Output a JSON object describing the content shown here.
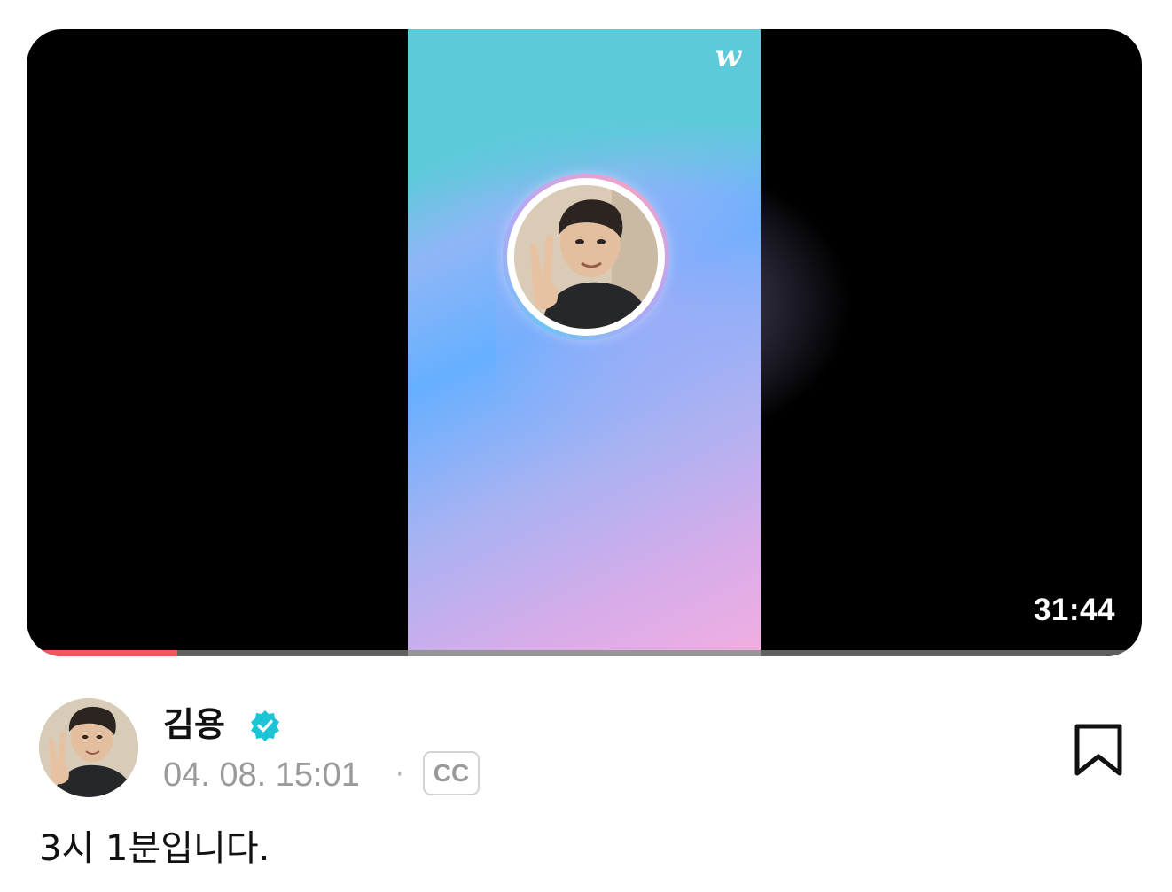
{
  "player": {
    "logo_text": "w",
    "duration": "31:44",
    "progress": 0.135,
    "colors": {
      "progress_fill": "#ee5a5a",
      "progress_track": "#5f5f5f",
      "gradient_top": "#5ccad9",
      "gradient_mid": "#66b0ff",
      "gradient_bottom": "#f2aee0"
    }
  },
  "post": {
    "author": "김용",
    "verified_icon": "verified-badge-icon",
    "timestamp": "04. 08. 15:01",
    "separator": "·",
    "cc_label": "CC",
    "bookmark_icon": "bookmark-icon",
    "caption": "3시 1분입니다.",
    "accent_color": "#1cc4d6"
  }
}
